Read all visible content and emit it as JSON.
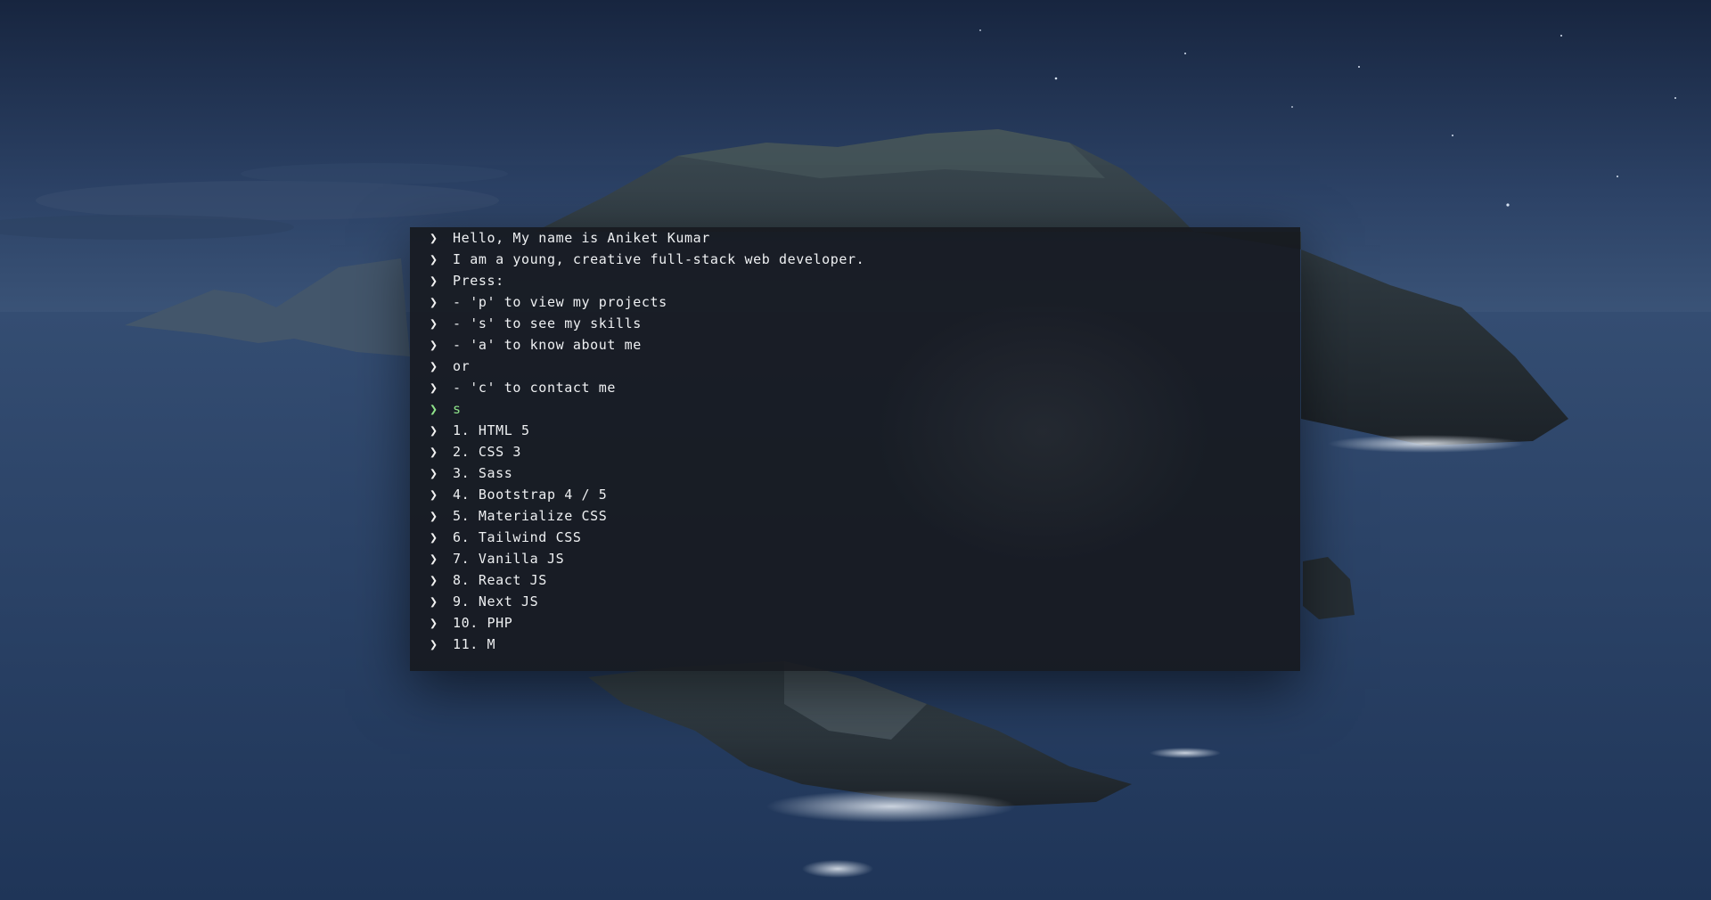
{
  "colors": {
    "sky_top": "#1b2a4a",
    "sky_bottom": "#3a5276",
    "ocean": "#2b4266",
    "terminal_bg": "#16181e",
    "text": "#eef0f2",
    "input_green": "#8fe38a"
  },
  "icons": {
    "prompt_icon": "chevron-right"
  },
  "terminal": {
    "prompt_symbol": "❯",
    "lines": [
      {
        "type": "output",
        "text": "Hello, My name is Aniket Kumar"
      },
      {
        "type": "output",
        "text": "I am a young, creative full-stack web developer."
      },
      {
        "type": "output",
        "text": "Press:"
      },
      {
        "type": "output",
        "text": "- 'p' to view my projects"
      },
      {
        "type": "output",
        "text": "- 's' to see my skills"
      },
      {
        "type": "output",
        "text": "- 'a' to know about me"
      },
      {
        "type": "output",
        "text": "or"
      },
      {
        "type": "output",
        "text": "- 'c' to contact me"
      },
      {
        "type": "input",
        "text": "s"
      },
      {
        "type": "output",
        "text": "1. HTML 5"
      },
      {
        "type": "output",
        "text": "2. CSS 3"
      },
      {
        "type": "output",
        "text": "3. Sass"
      },
      {
        "type": "output",
        "text": "4. Bootstrap 4 / 5"
      },
      {
        "type": "output",
        "text": "5. Materialize CSS"
      },
      {
        "type": "output",
        "text": "6. Tailwind CSS"
      },
      {
        "type": "output",
        "text": "7. Vanilla JS"
      },
      {
        "type": "output",
        "text": "8. React JS"
      },
      {
        "type": "output",
        "text": "9. Next JS"
      },
      {
        "type": "output",
        "text": "10. PHP"
      },
      {
        "type": "output",
        "text": "11. M"
      }
    ]
  }
}
